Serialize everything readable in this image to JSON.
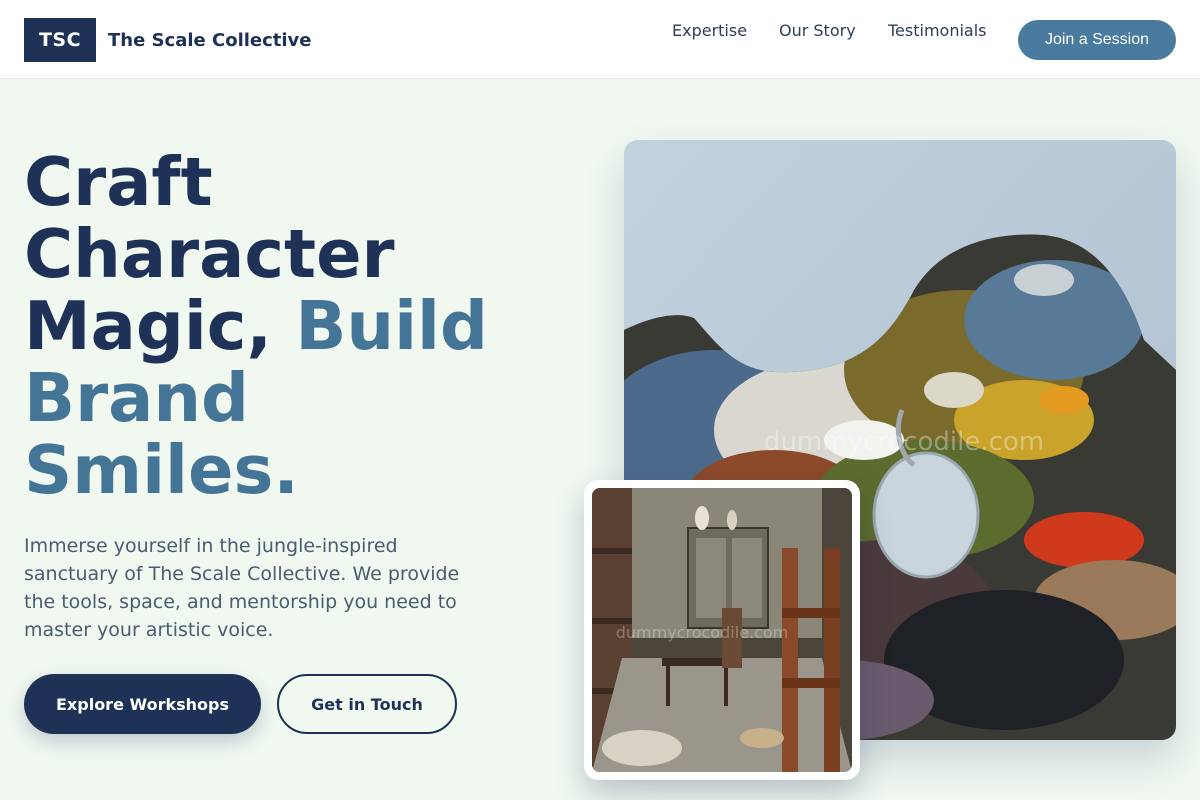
{
  "brand": {
    "badge": "TSC",
    "name": "The Scale Collective"
  },
  "nav": {
    "links": [
      "Expertise",
      "Our Story",
      "Testimonials"
    ],
    "cta": "Join a Session"
  },
  "hero": {
    "title_line1": "Craft",
    "title_line2": "Character",
    "title_line3": "Magic, ",
    "title_accent1": "Build",
    "title_accent2": "Brand",
    "title_accent3": "Smiles.",
    "description": "Immerse yourself in the jungle-inspired sanctuary of The Scale Collective. We provide the tools, space, and mentorship you need to master your artistic voice.",
    "primary_button": "Explore Workshops",
    "secondary_button": "Get in Touch"
  },
  "images": {
    "main_watermark": "dummycrocodile.com",
    "inset_watermark": "dummycrocodile.com"
  },
  "colors": {
    "navy": "#1e3157",
    "accent_blue": "#447597",
    "button_blue": "#487b9e",
    "background": "#f0f8f0"
  }
}
